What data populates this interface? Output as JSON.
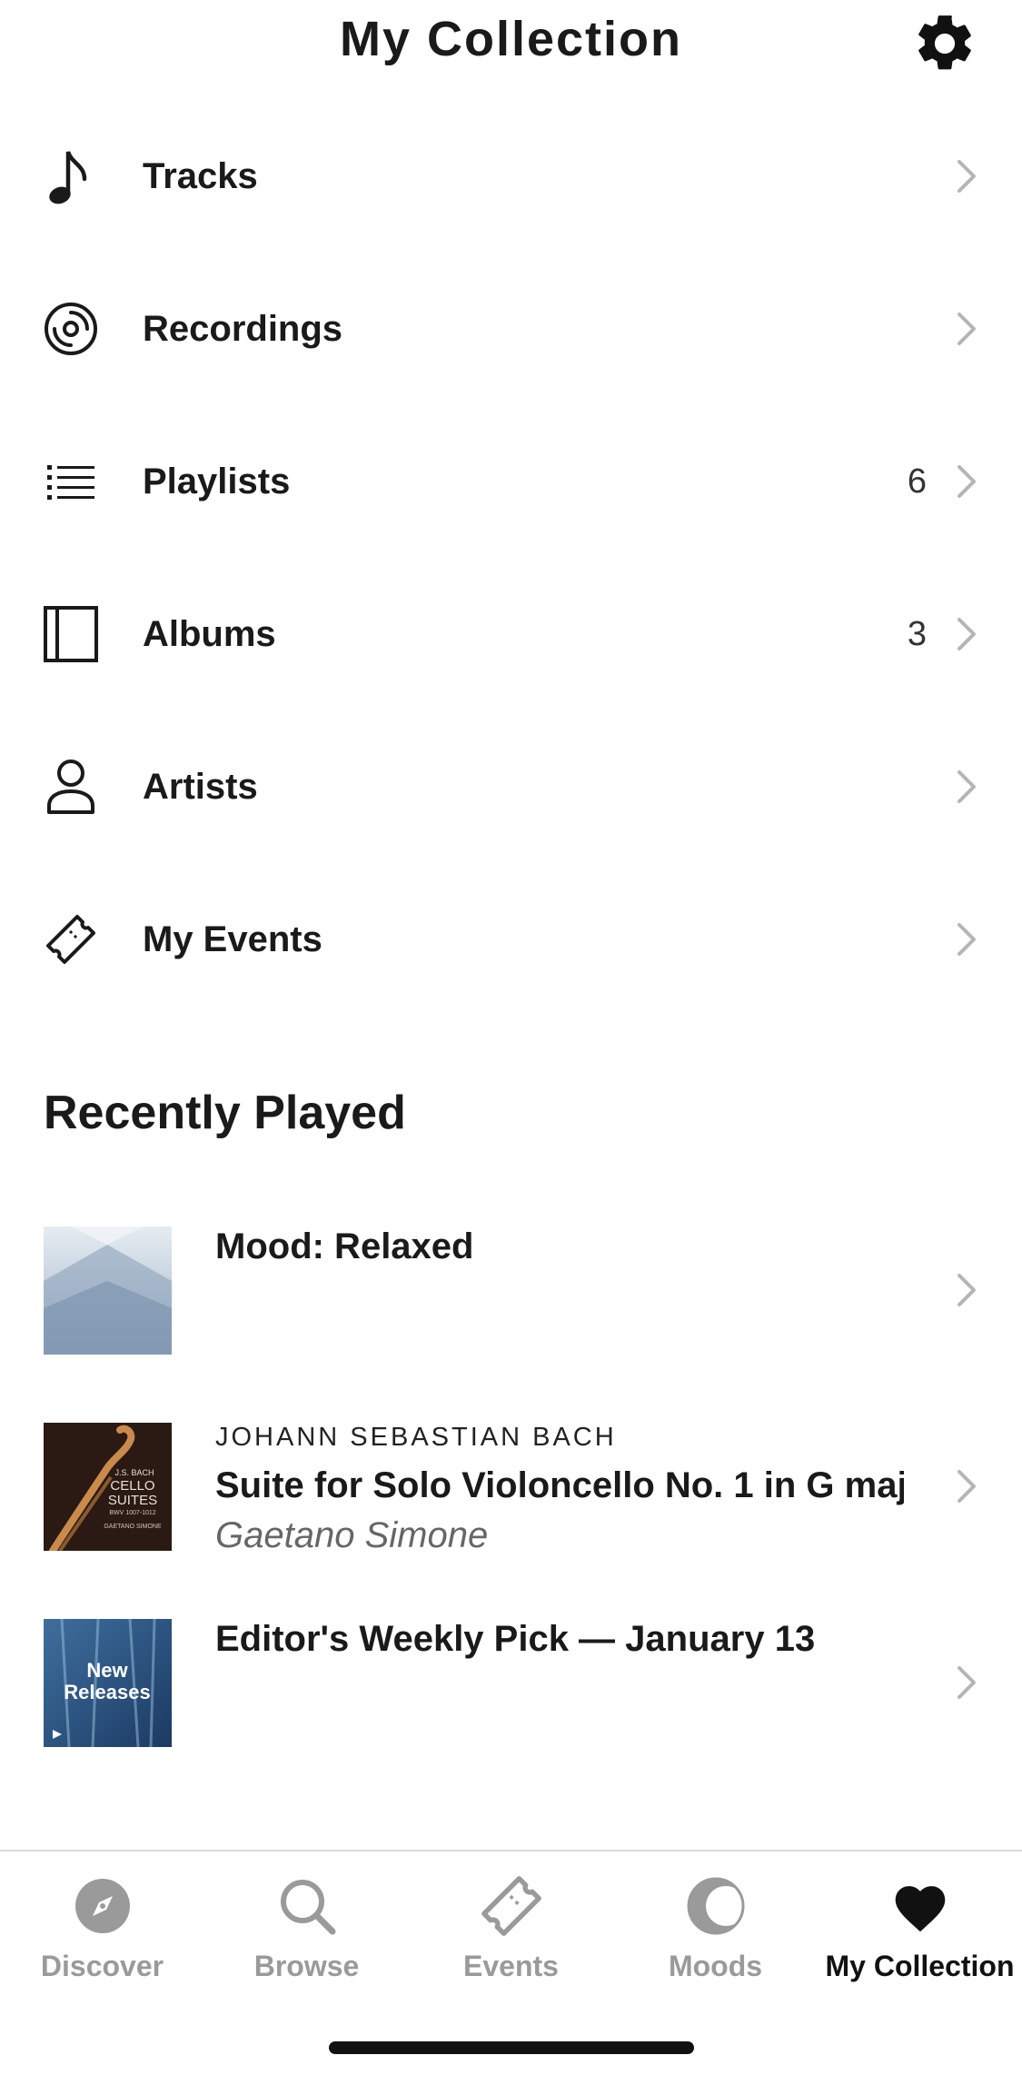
{
  "header": {
    "title": "My Collection"
  },
  "menu": {
    "items": [
      {
        "label": "Tracks",
        "count": ""
      },
      {
        "label": "Recordings",
        "count": ""
      },
      {
        "label": "Playlists",
        "count": "6"
      },
      {
        "label": "Albums",
        "count": "3"
      },
      {
        "label": "Artists",
        "count": ""
      },
      {
        "label": "My Events",
        "count": ""
      }
    ]
  },
  "recently_played": {
    "title": "Recently Played",
    "items": [
      {
        "kicker": "",
        "title": "Mood: Relaxed",
        "subtitle": ""
      },
      {
        "kicker": "JOHANN SEBASTIAN BACH",
        "title": "Suite for Solo Violoncello No. 1 in G maj...",
        "subtitle": "Gaetano Simone",
        "art_text": [
          "J.S. BACH",
          "CELLO",
          "SUITES",
          "BWV 1007-1012",
          "GAETANO SIMONE"
        ]
      },
      {
        "kicker": "",
        "title": "Editor's Weekly Pick — January 13",
        "subtitle": "",
        "art_text": [
          "New",
          "Releases"
        ]
      }
    ]
  },
  "tabbar": {
    "tabs": [
      {
        "label": "Discover",
        "icon": "compass-icon",
        "active": false
      },
      {
        "label": "Browse",
        "icon": "search-icon",
        "active": false
      },
      {
        "label": "Events",
        "icon": "ticket-icon",
        "active": false
      },
      {
        "label": "Moods",
        "icon": "moon-icon",
        "active": false
      },
      {
        "label": "My Collection",
        "icon": "heart-icon",
        "active": true
      }
    ]
  },
  "colors": {
    "text": "#1a1a1a",
    "inactive_tab": "#9a9a9a",
    "chevron": "#b5b5b5",
    "divider": "#d8d8d8"
  }
}
